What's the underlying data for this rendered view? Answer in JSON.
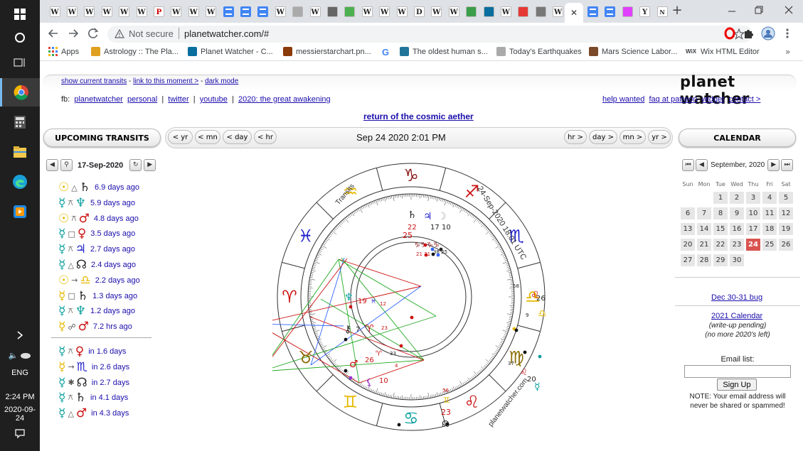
{
  "taskbar": {
    "clock_time": "2:24 PM",
    "clock_date": "2020-09-24",
    "language": "ENG",
    "colors": {
      "background": "#1f1f1f",
      "chrome_accent": "#f2b01e"
    }
  },
  "browser": {
    "security_label": "Not secure",
    "url": "planetwatcher.com/#",
    "new_tab_symbol": "+",
    "bookmarks": [
      {
        "label": "Apps",
        "icon": "apps-grid-icon"
      },
      {
        "label": "Astrology :: The Pla...",
        "icon": "astrology-favicon"
      },
      {
        "label": "Planet Watcher - C...",
        "icon": "planetwatcher-favicon"
      },
      {
        "label": "messierstarchart.pn...",
        "icon": "starchart-favicon"
      },
      {
        "label": "G",
        "icon": "google-favicon"
      },
      {
        "label": "The oldest human s...",
        "icon": "wordpress-favicon"
      },
      {
        "label": "Today's Earthquakes",
        "icon": "earthquake-favicon"
      },
      {
        "label": "Mars Science Labor...",
        "icon": "mars-favicon"
      },
      {
        "label": "Wix HTML Editor",
        "icon": "wix-favicon"
      }
    ],
    "bookmarks_overflow": "»",
    "tabs": [
      "W",
      "W",
      "W",
      "W",
      "W",
      "W",
      "Pg",
      "W",
      "W",
      "W",
      "docs",
      "docs",
      "docs",
      "W",
      "img",
      "W",
      "moon",
      "play",
      "W",
      "W",
      "W",
      "D",
      "W",
      "W",
      "wiki",
      "ufo",
      "W",
      "circle",
      "moon2",
      "W",
      "active",
      "docs",
      "docs",
      "flower",
      "Y",
      "Nu"
    ]
  },
  "page": {
    "top_links": [
      {
        "label": "show current transits"
      },
      {
        "label": "link to this moment >"
      },
      {
        "label": "dark mode"
      }
    ],
    "separator": "-",
    "fb_label": "fb:",
    "fb_links": [
      {
        "label": "planetwatcher"
      },
      {
        "label": "personal"
      },
      {
        "label": "twitter"
      },
      {
        "label": "youtube"
      },
      {
        "label": "2020: the great awakening"
      }
    ],
    "pipe": "|",
    "logo_text": "planet watcher",
    "right_links": [
      {
        "label": "help wanted"
      },
      {
        "label": "faq at patreon"
      },
      {
        "label": "widget"
      },
      {
        "label": "contact >"
      }
    ],
    "headline_link": "return of the cosmic aether",
    "left_panel": {
      "title": "UPCOMING TRANSITS",
      "date": "17-Sep-2020",
      "past_transits": [
        {
          "p1": "☉",
          "c1": "#e6b800",
          "asp": "△",
          "p2": "♄",
          "c2": "#222",
          "time": "6.9 days ago"
        },
        {
          "p1": "☿",
          "c1": "#0a9e9e",
          "asp": "⚻",
          "p2": "♆",
          "c2": "#0a9e9e",
          "time": "5.9 days ago"
        },
        {
          "p1": "☉",
          "c1": "#e6b800",
          "asp": "⚻",
          "p2": "♂",
          "c2": "#cc1111",
          "time": "4.8 days ago"
        },
        {
          "p1": "☿",
          "c1": "#0a9e9e",
          "asp": "□",
          "p2": "♀",
          "c2": "#cc1111",
          "time": "3.5 days ago"
        },
        {
          "p1": "☿",
          "c1": "#0a9e9e",
          "asp": "⚻",
          "p2": "♃",
          "c2": "#2222cc",
          "time": "2.7 days ago"
        },
        {
          "p1": "☿",
          "c1": "#0a9e9e",
          "asp": "△",
          "p2": "☊",
          "c2": "#222",
          "time": "2.4 days ago"
        },
        {
          "p1": "☉",
          "c1": "#e6b800",
          "asp": "→",
          "p2": "♎",
          "c2": "#e6b800",
          "time": "2.2 days ago"
        },
        {
          "p1": "☿",
          "c1": "#e6b800",
          "asp": "□",
          "p2": "♄",
          "c2": "#222",
          "time": "1.3 days ago"
        },
        {
          "p1": "☿",
          "c1": "#0a9e9e",
          "asp": "⚻",
          "p2": "♆",
          "c2": "#0a9e9e",
          "time": "1.2 days ago"
        },
        {
          "p1": "☿",
          "c1": "#e6b800",
          "asp": "☍",
          "p2": "♂",
          "c2": "#cc1111",
          "time": "7.2 hrs ago"
        }
      ],
      "future_transits": [
        {
          "p1": "☿",
          "c1": "#0a9e9e",
          "asp": "⚻",
          "p2": "♀",
          "c2": "#cc1111",
          "time": "in 1.6 days"
        },
        {
          "p1": "☿",
          "c1": "#e6b800",
          "asp": "→",
          "p2": "♏",
          "c2": "#2222cc",
          "time": "in 2.6 days"
        },
        {
          "p1": "☿",
          "c1": "#0a9e9e",
          "asp": "✱",
          "p2": "☊",
          "c2": "#222",
          "time": "in 2.7 days"
        },
        {
          "p1": "☿",
          "c1": "#0a9e9e",
          "asp": "⚻",
          "p2": "♄",
          "c2": "#222",
          "time": "in 4.1 days"
        },
        {
          "p1": "☿",
          "c1": "#0a9e9e",
          "asp": "△",
          "p2": "♂",
          "c2": "#cc1111",
          "time": "in 4.3 days"
        }
      ]
    },
    "time_nav": {
      "left": [
        "< yr",
        "< mn",
        "< day",
        "< hr"
      ],
      "right": [
        "hr >",
        "day >",
        "mn >",
        "yr >"
      ],
      "current": "Sep 24 2020 2:01 PM"
    },
    "wheel": {
      "date_label": "24-Sep-2020 18:01 UTC",
      "transits_label": "Transits",
      "site_label": "planetwatcher.com",
      "zodiac": [
        {
          "glyph": "♑",
          "color": "#8b1a1a"
        },
        {
          "glyph": "♐",
          "color": "#cc1111"
        },
        {
          "glyph": "♏",
          "color": "#2222cc"
        },
        {
          "glyph": "♎",
          "color": "#e6b800"
        },
        {
          "glyph": "♍",
          "color": "#8b6b00"
        },
        {
          "glyph": "♌",
          "color": "#cc1111"
        },
        {
          "glyph": "♋",
          "color": "#0a9e9e"
        },
        {
          "glyph": "♊",
          "color": "#e6b800"
        },
        {
          "glyph": "♉",
          "color": "#8b6b00"
        },
        {
          "glyph": "♈",
          "color": "#cc1111"
        },
        {
          "glyph": "♓",
          "color": "#2222cc"
        },
        {
          "glyph": "♒",
          "color": "#e6b800"
        }
      ],
      "planet_labels": [
        {
          "text": "♄",
          "color": "#222"
        },
        {
          "text": "♃",
          "color": "#2222cc"
        },
        {
          "text": "☽",
          "color": "#aaa"
        },
        {
          "text": "22",
          "color": "#cc1111"
        },
        {
          "text": "17",
          "color": "#222"
        },
        {
          "text": "10",
          "color": "#222"
        },
        {
          "text": "25",
          "color": "#cc1111"
        },
        {
          "text": "♑♑♑♑",
          "color": "#8b1a1a"
        },
        {
          "text": "21 31",
          "color": "#cc1111"
        },
        {
          "text": "38 25",
          "color": "#222"
        },
        {
          "text": "♆",
          "color": "#0a9e9e"
        },
        {
          "text": "19",
          "color": "#cc1111"
        },
        {
          "text": "♓",
          "color": "#2222cc"
        },
        {
          "text": "12",
          "color": "#cc1111"
        },
        {
          "text": "⚷",
          "color": "#222"
        },
        {
          "text": "7",
          "color": "#222"
        },
        {
          "text": "♈",
          "color": "#cc1111"
        },
        {
          "text": "23",
          "color": "#cc1111"
        },
        {
          "text": "♂",
          "color": "#cc1111"
        },
        {
          "text": "26",
          "color": "#cc1111"
        },
        {
          "text": "♈",
          "color": "#cc1111"
        },
        {
          "text": "33",
          "color": "#222"
        },
        {
          "text": "4",
          "color": "#cc1111"
        },
        {
          "text": "⚸",
          "color": "#9933cc"
        },
        {
          "text": "10",
          "color": "#cc1111"
        },
        {
          "text": "♌",
          "color": "#cc1111"
        },
        {
          "text": "26",
          "color": "#222"
        },
        {
          "text": "58",
          "color": "#222"
        },
        {
          "text": "9",
          "color": "#222"
        },
        {
          "text": "♎",
          "color": "#e6b800"
        },
        {
          "text": "2",
          "color": "#222"
        },
        {
          "text": "☉",
          "color": "#e6b800"
        },
        {
          "text": "♌",
          "color": "#cc1111"
        },
        {
          "text": "20",
          "color": "#222"
        },
        {
          "text": "37",
          "color": "#222"
        },
        {
          "text": "☿",
          "color": "#0a9e9e"
        },
        {
          "text": "56",
          "color": "#cc1111"
        },
        {
          "text": "♊",
          "color": "#e6b800"
        },
        {
          "text": "23",
          "color": "#cc1111"
        },
        {
          "text": "☊",
          "color": "#222"
        }
      ]
    },
    "calendar": {
      "title": "CALENDAR",
      "month": "September, 2020",
      "weekdays": [
        "Sun",
        "Mon",
        "Tue",
        "Wed",
        "Thu",
        "Fri",
        "Sat"
      ],
      "weeks": [
        [
          "",
          "",
          "1",
          "2",
          "3",
          "4",
          "5"
        ],
        [
          "6",
          "7",
          "8",
          "9",
          "10",
          "11",
          "12"
        ],
        [
          "13",
          "14",
          "15",
          "16",
          "17",
          "18",
          "19"
        ],
        [
          "20",
          "21",
          "22",
          "23",
          "24",
          "25",
          "26"
        ],
        [
          "27",
          "28",
          "29",
          "30",
          "",
          "",
          ""
        ]
      ],
      "selected_day": "24",
      "colors": {
        "selected": "#d9534f"
      },
      "bug_link": "Dec 30-31 bug",
      "next_cal_link": "2021 Calendar",
      "next_cal_note1": "(write-up pending)",
      "next_cal_note2": "(no more 2020's left)",
      "email_label": "Email list:",
      "email_placeholder": "",
      "signup_button": "Sign Up",
      "note": "NOTE: Your email address will never be shared or spammed!"
    }
  }
}
